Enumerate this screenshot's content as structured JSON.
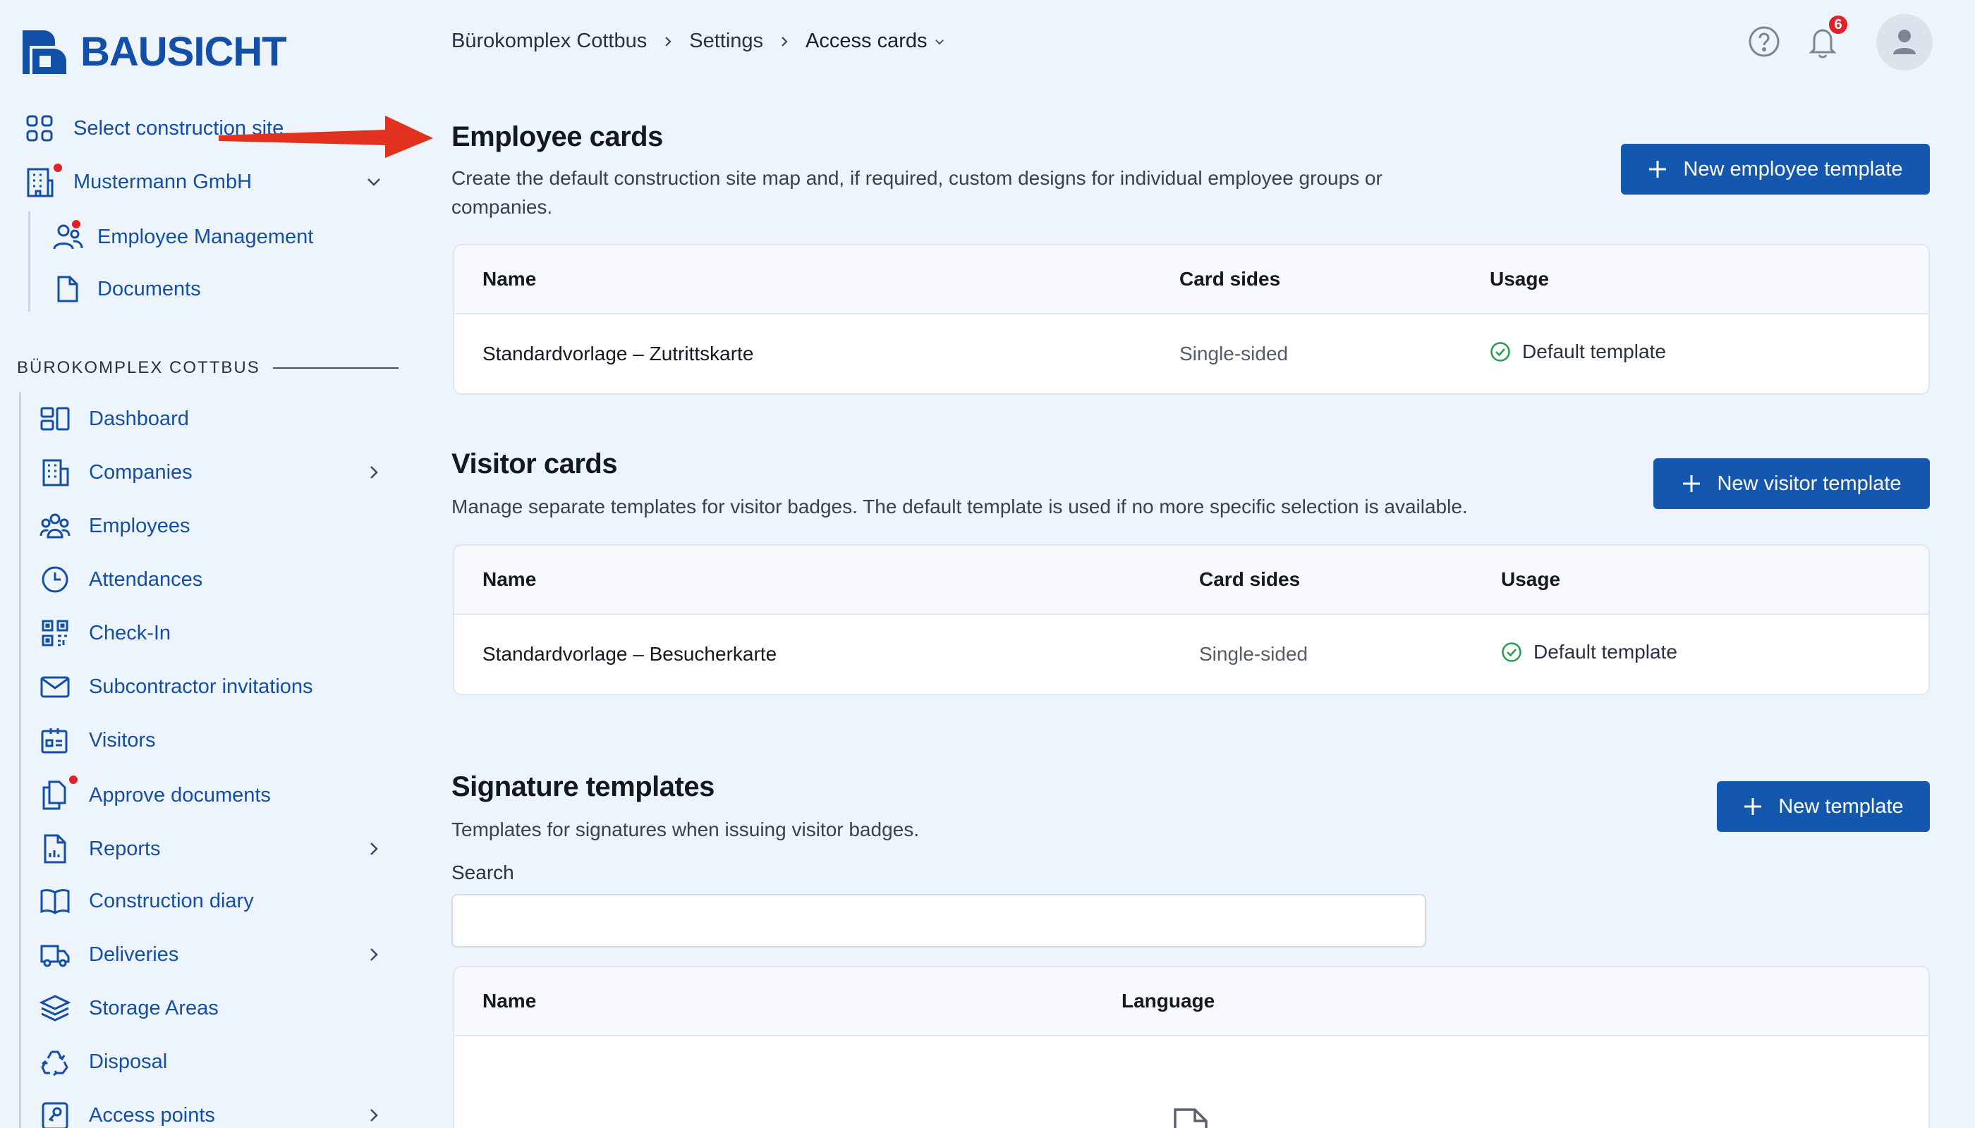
{
  "brand": {
    "name": "BAUSICHT",
    "color": "#134fa8"
  },
  "sidebar": {
    "select_site": "Select construction site",
    "company": "Mustermann GmbH",
    "company_sub": [
      {
        "label": "Employee Management",
        "icon": "employees-icon",
        "has_dot": true
      },
      {
        "label": "Documents",
        "icon": "document-icon"
      }
    ],
    "section_title": "BÜROKOMPLEX COTTBUS",
    "items": [
      {
        "label": "Dashboard",
        "icon": "dashboard-icon"
      },
      {
        "label": "Companies",
        "icon": "building-icon",
        "expandable": true
      },
      {
        "label": "Employees",
        "icon": "people-icon"
      },
      {
        "label": "Attendances",
        "icon": "clock-icon"
      },
      {
        "label": "Check-In",
        "icon": "qr-code-icon"
      },
      {
        "label": "Subcontractor invitations",
        "icon": "mail-icon"
      },
      {
        "label": "Visitors",
        "icon": "visitor-badge-icon"
      },
      {
        "label": "Approve documents",
        "icon": "documents-copy-icon",
        "has_dot": true
      },
      {
        "label": "Reports",
        "icon": "report-icon",
        "expandable": true
      },
      {
        "label": "Construction diary",
        "icon": "book-icon"
      },
      {
        "label": "Deliveries",
        "icon": "truck-icon",
        "expandable": true
      },
      {
        "label": "Storage Areas",
        "icon": "layers-icon"
      },
      {
        "label": "Disposal",
        "icon": "recycle-icon"
      },
      {
        "label": "Access points",
        "icon": "key-card-icon",
        "expandable": true
      }
    ]
  },
  "header": {
    "breadcrumb": [
      "Bürokomplex Cottbus",
      "Settings",
      "Access cards"
    ],
    "notifications_count": "6"
  },
  "employee_cards": {
    "title": "Employee cards",
    "description_line1": "Create the default construction site map and, if required, custom designs for individual employee groups or",
    "description_line2": "companies.",
    "button": "New employee template",
    "columns": [
      "Name",
      "Card sides",
      "Usage"
    ],
    "rows": [
      {
        "name": "Standardvorlage – Zutrittskarte",
        "sides": "Single-sided",
        "usage": "Default template"
      }
    ]
  },
  "visitor_cards": {
    "title": "Visitor cards",
    "description": "Manage separate templates for visitor badges. The default template is used if no more specific selection is available.",
    "button": "New visitor template",
    "columns": [
      "Name",
      "Card sides",
      "Usage"
    ],
    "rows": [
      {
        "name": "Standardvorlage – Besucherkarte",
        "sides": "Single-sided",
        "usage": "Default template"
      }
    ]
  },
  "signature_templates": {
    "title": "Signature templates",
    "description": "Templates for signatures when issuing visitor badges.",
    "button": "New template",
    "search_label": "Search",
    "search_value": "",
    "columns": [
      "Name",
      "Language"
    ]
  },
  "colors": {
    "primary": "#1457ae",
    "link": "#134fa8",
    "success": "#22a04b",
    "alert": "#e0202a",
    "annotation_arrow": "#e0321e"
  }
}
